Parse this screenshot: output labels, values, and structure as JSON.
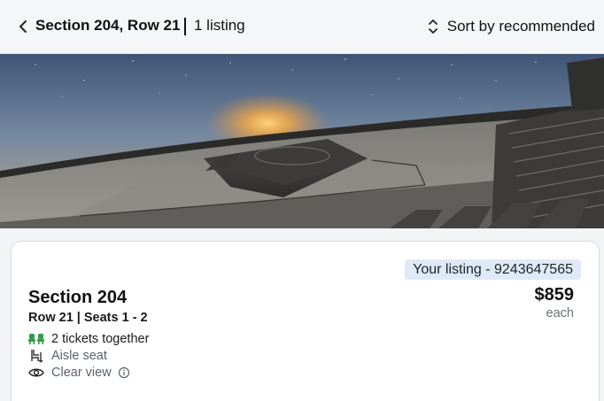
{
  "header": {
    "title": "Section 204, Row 21",
    "listing_count": "1 listing",
    "sort_label": "Sort by recommended",
    "back_icon": "chevron-left-icon",
    "sort_icon": "sort-updown-icon"
  },
  "listing": {
    "badge": "Your listing - 9243647565",
    "section": "Section 204",
    "row_seats": "Row 21 | Seats 1 - 2",
    "price": "$859",
    "price_unit": "each",
    "features": [
      {
        "text": "2 tickets together",
        "icon": "seats-icon"
      },
      {
        "text": "Aisle seat",
        "icon": "aisle-seat-icon"
      },
      {
        "text": "Clear view",
        "icon": "eye-icon",
        "extra_icon": "info-icon"
      }
    ]
  },
  "colors": {
    "badge_bg": "#dfeaf7",
    "seats_icon": "#2e9e44",
    "muted_text": "#5a6168"
  }
}
